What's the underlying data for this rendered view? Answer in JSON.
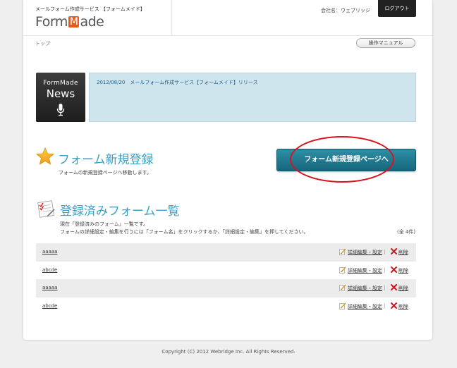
{
  "header": {
    "service_name": "メールフォーム作成サービス 【フォームメイド】",
    "logo_prefix": "Form",
    "logo_mark": "M",
    "logo_suffix": "ade",
    "company": "会社名：ウェブリッジ",
    "logout_label": "ログアウト",
    "breadcrumb": "トップ",
    "manual_label": "操作マニュアル"
  },
  "news": {
    "badge_line1": "FormMade",
    "badge_line2": "News",
    "items": [
      "2012/08/20　メールフォーム作成サービス【フォームメイド】リリース"
    ]
  },
  "new_form": {
    "title": "フォーム新規登録",
    "description": "フォームの新規登録ページへ移動します。",
    "button_label": "フォーム新規登録ページへ"
  },
  "form_list": {
    "title": "登録済みフォーム一覧",
    "desc1": "現在「登録済みのフォーム」一覧です。",
    "desc2": "フォームの詳細設定・編集を行うには「フォーム名」をクリックするか、「詳細設定・編集」を押してください。",
    "count": "(全 4件)",
    "edit_label": "詳細編集・設定",
    "separator": "|",
    "delete_label": "削除",
    "rows": [
      {
        "name": "aaaaa"
      },
      {
        "name": "abcde"
      },
      {
        "name": "aaaaa"
      },
      {
        "name": "abcde"
      }
    ]
  },
  "footer": {
    "copyright": "Copyright (C) 2012 Webridge Inc. All Rights Reserved."
  },
  "colors": {
    "accent_title": "#3aa0c8",
    "primary_button": "#1f7a90",
    "news_background": "#cfe5ee",
    "highlight_oval": "#d8141e"
  }
}
